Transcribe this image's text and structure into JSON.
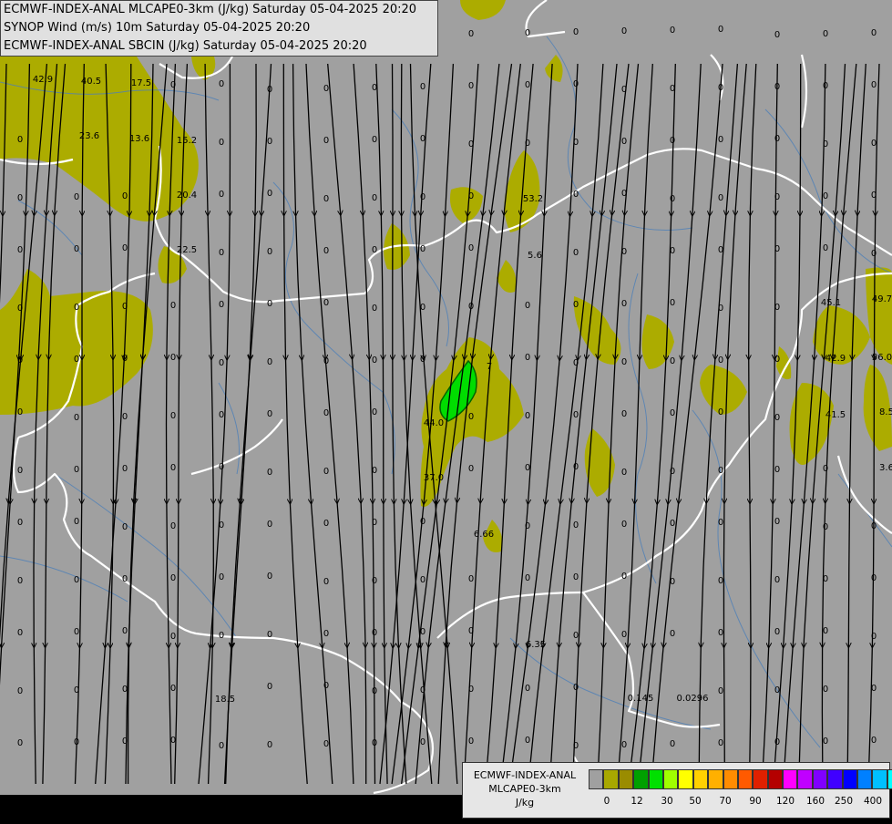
{
  "header": {
    "lines": [
      "ECMWF-INDEX-ANAL MLCAPE0-3km (J/kg) Saturday 05-04-2025 20:20",
      "SYNOP Wind (m/s) 10m Saturday 05-04-2025 20:20",
      "ECMWF-INDEX-ANAL SBCIN (J/kg) Saturday 05-04-2025 20:20"
    ]
  },
  "legend": {
    "title_lines": [
      "ECMWF-INDEX-ANAL",
      "MLCAPE0-3km",
      "J/kg"
    ],
    "swatch_colors": [
      "#a0a0a0",
      "#a8a800",
      "#9a8c00",
      "#00a000",
      "#00e000",
      "#a0ff00",
      "#ffff00",
      "#ffd000",
      "#ffb000",
      "#ff8c00",
      "#ff5a00",
      "#e02000",
      "#b40000",
      "#ff00ff",
      "#c000ff",
      "#8000ff",
      "#4000ff",
      "#0000ff",
      "#0080ff",
      "#00c0ff",
      "#00ffff",
      "#a0ffff",
      "#ffffff"
    ],
    "tick_labels": [
      "0",
      "12",
      "30",
      "50",
      "70",
      "90",
      "120",
      "160",
      "250",
      "400"
    ]
  },
  "colors": {
    "map_background": "#a0a0a0",
    "cape_low": "#acac00",
    "cape_mid": "#00dd00",
    "border": "#ffffff",
    "river": "#4d7fb8",
    "streamline": "#000000"
  },
  "field_values": [
    "42.9",
    "40.5",
    "17.5",
    "23.6",
    "13.6",
    "15.2",
    "20.4",
    "22.5",
    "53.2",
    "5.6",
    "45.1",
    "49.7",
    "56.0",
    "42.9",
    "41.5",
    "8.5",
    "3.6",
    "7",
    "44.0",
    "37.0",
    "6.66",
    "6.35",
    "0.145",
    "0.0296",
    "18.5",
    "0",
    "5",
    "1",
    "9",
    "8"
  ]
}
